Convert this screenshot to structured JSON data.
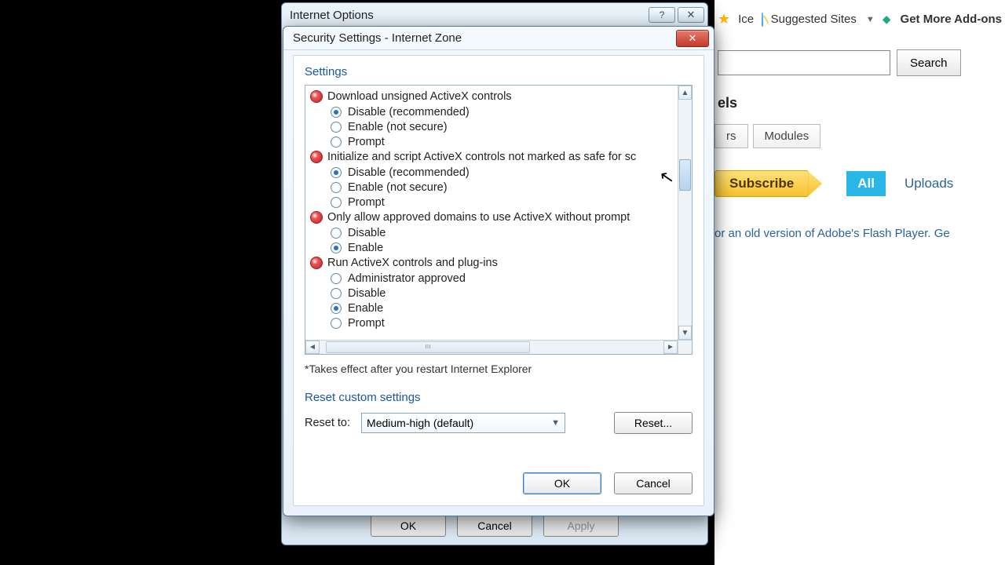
{
  "bg": {
    "ice_text": "Ice",
    "suggested": "Suggested Sites",
    "addons": "Get More Add-ons",
    "search_btn": "Search",
    "channels_heading_fragment": "els",
    "tab_rs_fragment": "rs",
    "tab_modules": "Modules",
    "subscribe": "Subscribe",
    "tab_all": "All",
    "tab_uploads": "Uploads",
    "flash_text": "or an old version of Adobe's Flash Player. Ge"
  },
  "io": {
    "title": "Internet Options",
    "help_glyph": "?",
    "close_glyph": "✕",
    "ok": "OK",
    "cancel": "Cancel",
    "apply": "Apply"
  },
  "ss": {
    "title": "Security Settings - Internet Zone",
    "close_glyph": "✕",
    "group": "Settings",
    "categories": [
      {
        "label": "Download unsigned ActiveX controls",
        "options": [
          {
            "label": "Disable (recommended)",
            "checked": true
          },
          {
            "label": "Enable (not secure)",
            "checked": false
          },
          {
            "label": "Prompt",
            "checked": false
          }
        ]
      },
      {
        "label": "Initialize and script ActiveX controls not marked as safe for sc",
        "options": [
          {
            "label": "Disable (recommended)",
            "checked": true
          },
          {
            "label": "Enable (not secure)",
            "checked": false
          },
          {
            "label": "Prompt",
            "checked": false
          }
        ]
      },
      {
        "label": "Only allow approved domains to use ActiveX without prompt",
        "options": [
          {
            "label": "Disable",
            "checked": false
          },
          {
            "label": "Enable",
            "checked": true
          }
        ]
      },
      {
        "label": "Run ActiveX controls and plug-ins",
        "options": [
          {
            "label": "Administrator approved",
            "checked": false
          },
          {
            "label": "Disable",
            "checked": false
          },
          {
            "label": "Enable",
            "checked": true
          },
          {
            "label": "Prompt",
            "checked": false
          }
        ]
      }
    ],
    "note": "*Takes effect after you restart Internet Explorer",
    "reset_group": "Reset custom settings",
    "reset_label": "Reset to:",
    "reset_value": "Medium-high (default)",
    "reset_btn": "Reset...",
    "ok": "OK",
    "cancel": "Cancel",
    "scroll_up": "▲",
    "scroll_down": "▼",
    "scroll_left": "◄",
    "scroll_right": "►",
    "hthumb_mark": "ııı"
  }
}
